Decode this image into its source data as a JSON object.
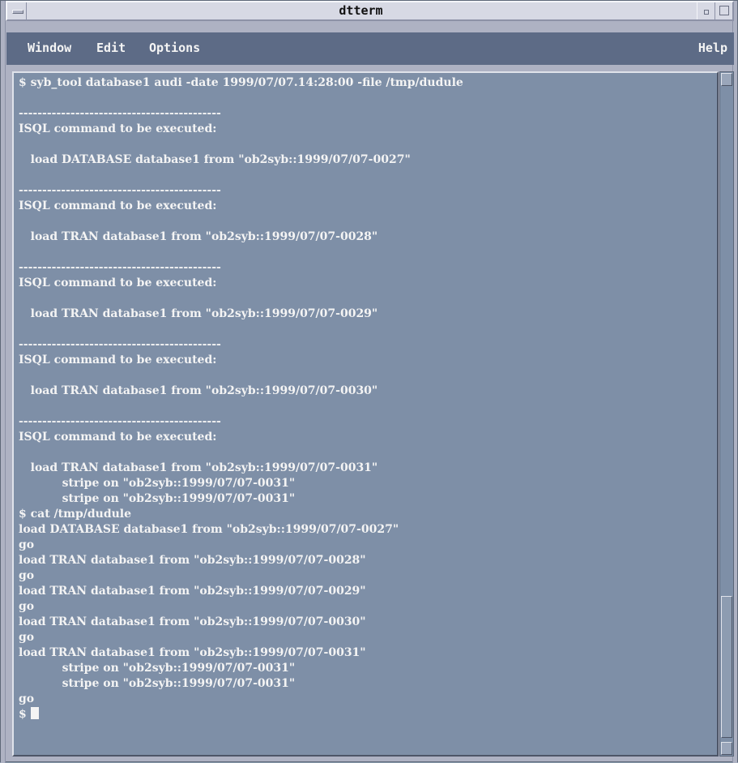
{
  "window": {
    "title": "dtterm"
  },
  "menubar": {
    "window": "Window",
    "edit": "Edit",
    "options": "Options",
    "help": "Help"
  },
  "terminal": {
    "lines": [
      "$ syb_tool database1 audi -date 1999/07/07.14:28:00 -file /tmp/dudule",
      "",
      "-------------------------------------------",
      "ISQL command to be executed:",
      "",
      "   load DATABASE database1 from \"ob2syb::1999/07/07-0027\"",
      "",
      "-------------------------------------------",
      "ISQL command to be executed:",
      "",
      "   load TRAN database1 from \"ob2syb::1999/07/07-0028\"",
      "",
      "-------------------------------------------",
      "ISQL command to be executed:",
      "",
      "   load TRAN database1 from \"ob2syb::1999/07/07-0029\"",
      "",
      "-------------------------------------------",
      "ISQL command to be executed:",
      "",
      "   load TRAN database1 from \"ob2syb::1999/07/07-0030\"",
      "",
      "-------------------------------------------",
      "ISQL command to be executed:",
      "",
      "   load TRAN database1 from \"ob2syb::1999/07/07-0031\"",
      "           stripe on \"ob2syb::1999/07/07-0031\"",
      "           stripe on \"ob2syb::1999/07/07-0031\"",
      "$ cat /tmp/dudule",
      "load DATABASE database1 from \"ob2syb::1999/07/07-0027\"",
      "go",
      "load TRAN database1 from \"ob2syb::1999/07/07-0028\"",
      "go",
      "load TRAN database1 from \"ob2syb::1999/07/07-0029\"",
      "go",
      "load TRAN database1 from \"ob2syb::1999/07/07-0030\"",
      "go",
      "load TRAN database1 from \"ob2syb::1999/07/07-0031\"",
      "           stripe on \"ob2syb::1999/07/07-0031\"",
      "           stripe on \"ob2syb::1999/07/07-0031\"",
      "go"
    ],
    "prompt": "$ "
  }
}
